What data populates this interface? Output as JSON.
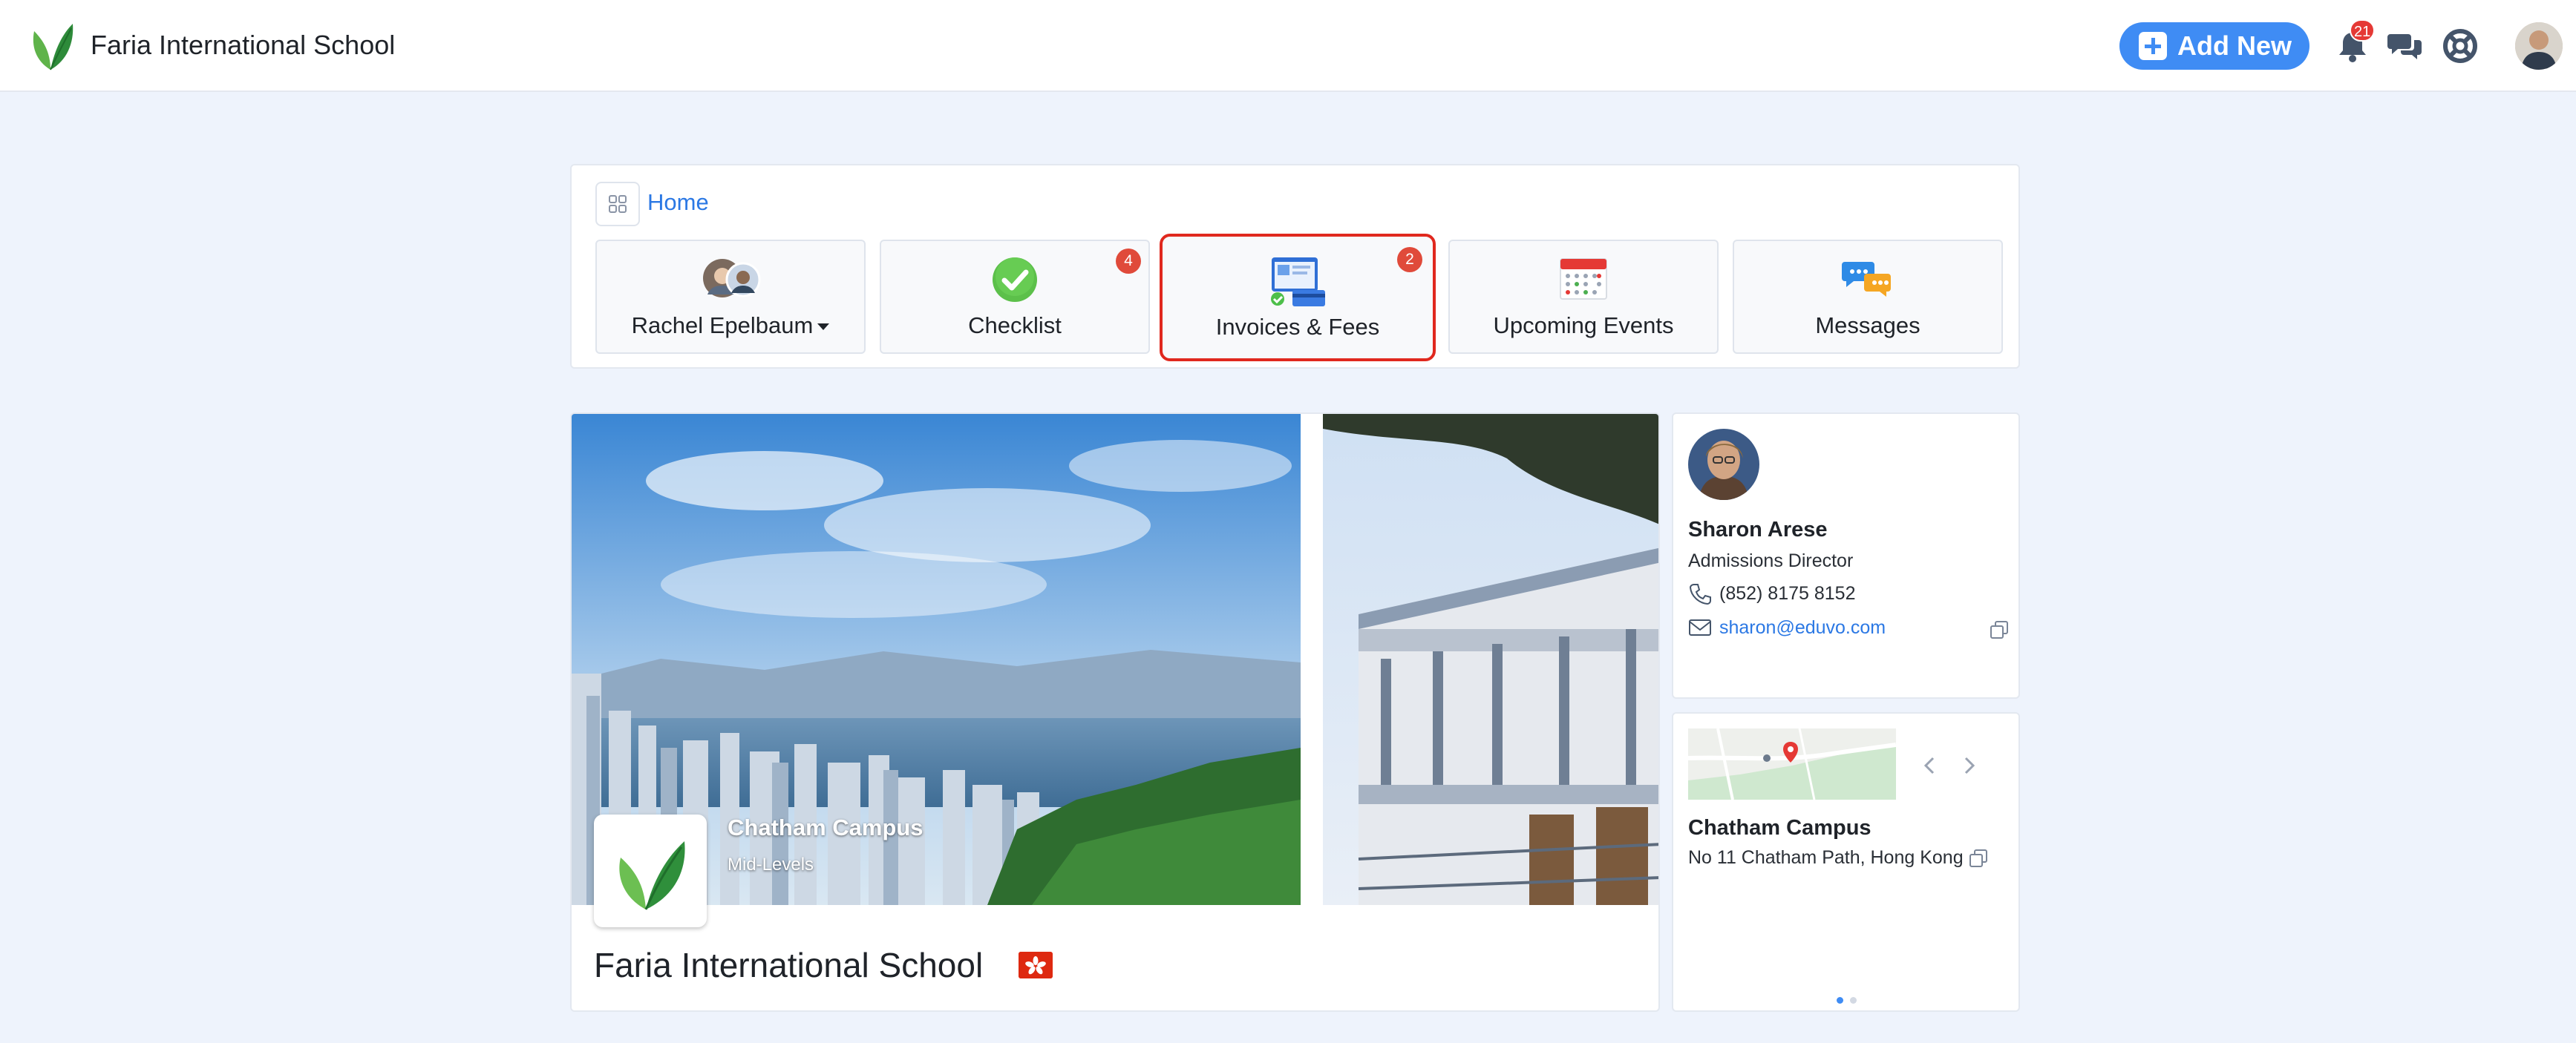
{
  "header": {
    "school_name": "Faria International School",
    "add_new_label": "Add New",
    "notification_count": "21"
  },
  "nav": {
    "home_label": "Home",
    "tiles": [
      {
        "label": "Rachel Epelbaum",
        "badge": ""
      },
      {
        "label": "Checklist",
        "badge": "4"
      },
      {
        "label": "Invoices & Fees",
        "badge": "2"
      },
      {
        "label": "Upcoming Events",
        "badge": ""
      },
      {
        "label": "Messages",
        "badge": ""
      }
    ],
    "selected_tile": "Invoices & Fees"
  },
  "hero": {
    "campus_name": "Chatham Campus",
    "campus_area": "Mid-Levels",
    "school_title": "Faria International School"
  },
  "contact": {
    "name": "Sharon Arese",
    "role": "Admissions Director",
    "phone": "(852) 8175 8152",
    "email": "sharon@eduvo.com"
  },
  "campus": {
    "name": "Chatham Campus",
    "address": "No 11 Chatham Path, Hong Kong",
    "carousel_total": 2,
    "carousel_active": 1
  },
  "colors": {
    "accent": "#3f8cf4",
    "link": "#2b78e4",
    "badge": "#e04a3a",
    "selected_border": "#e0281e",
    "background": "#eef3fc"
  }
}
